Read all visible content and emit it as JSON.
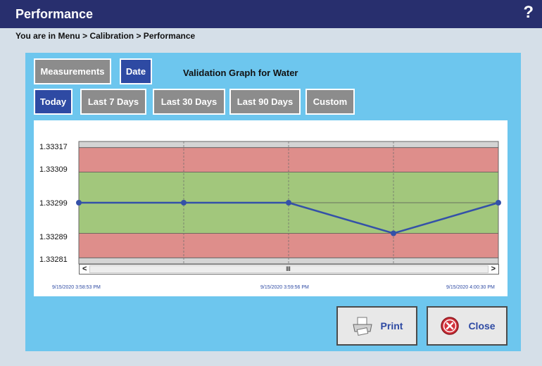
{
  "window": {
    "title": "Performance",
    "help_label": "?"
  },
  "breadcrumb": "You are in Menu > Calibration > Performance",
  "toolbar": {
    "mode_buttons": [
      {
        "label": "Measurements",
        "active": false
      },
      {
        "label": "Date",
        "active": true
      }
    ],
    "graph_title": "Validation Graph for Water",
    "range_buttons": [
      {
        "label": "Today",
        "active": true
      },
      {
        "label": "Last 7 Days",
        "active": false
      },
      {
        "label": "Last 30 Days",
        "active": false
      },
      {
        "label": "Last 90 Days",
        "active": false
      },
      {
        "label": "Custom",
        "active": false
      }
    ]
  },
  "chart_data": {
    "type": "line",
    "y_ticks": [
      "1.33317",
      "1.33309",
      "1.33299",
      "1.33289",
      "1.33281"
    ],
    "ylim": [
      1.33279,
      1.33319
    ],
    "x_tick_labels": [
      "9/15/2020 3:58:53 PM",
      "9/15/2020 3:59:56 PM",
      "9/15/2020 4:00:30 PM"
    ],
    "series": [
      {
        "values": [
          1.33299,
          1.33299,
          1.33299,
          1.33289,
          1.33299
        ]
      }
    ],
    "bands": [
      {
        "from": 1.33309,
        "to": 1.33317,
        "color": "#de8e8b"
      },
      {
        "from": 1.33289,
        "to": 1.33309,
        "color": "#a2c77c"
      },
      {
        "from": 1.33281,
        "to": 1.33289,
        "color": "#de8e8b"
      }
    ],
    "line_color": "#3451a8",
    "grid": true
  },
  "scrollbar": {
    "left_arrow": "<",
    "right_arrow": ">",
    "grip": "IIII"
  },
  "actions": {
    "print_label": "Print",
    "close_label": "Close"
  },
  "colors": {
    "title_bar": "#282f6e",
    "panel": "#6dc6ee",
    "active_button": "#2e4aa3",
    "inactive_button": "#8c8c8c"
  }
}
